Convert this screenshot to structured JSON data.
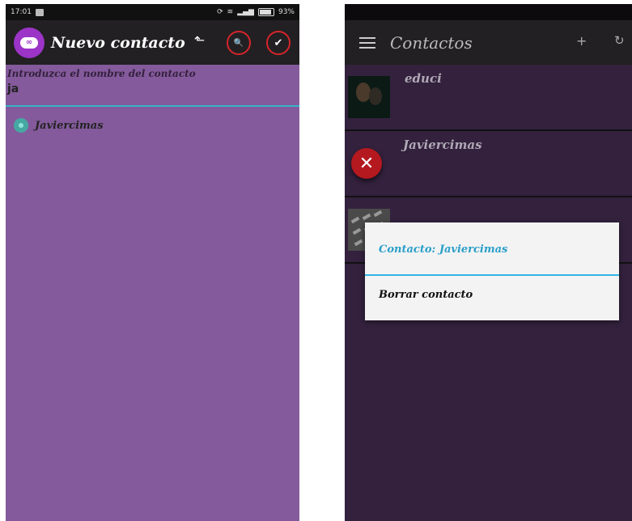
{
  "left": {
    "status": {
      "time": "17:01",
      "battery": "93%"
    },
    "toolbar": {
      "title": "Nuevo contacto",
      "logo_glyph": "∞",
      "back_glyph": "⬑",
      "search_glyph": "🔍",
      "accept_glyph": "✔"
    },
    "form": {
      "label": "Introduzca el nombre del contacto",
      "input_value": "ja"
    },
    "suggestions": [
      "Javiercimas"
    ]
  },
  "right": {
    "toolbar": {
      "title": "Contactos",
      "add_glyph": "+",
      "refresh_glyph": "↻"
    },
    "contacts": [
      {
        "name": "educi",
        "avatar": "photo"
      },
      {
        "name": "Javiercimas",
        "avatar": "close-icon"
      },
      {
        "name": "",
        "avatar": "keyboard-photo"
      }
    ],
    "dialog": {
      "title": "Contacto: Javiercimas",
      "items": [
        "Borrar contacto"
      ]
    }
  },
  "colors": {
    "left_background": "#845a9c",
    "right_background": "#33213d",
    "toolbar": "#222022",
    "accent": "#33b5e5",
    "action_ring": "#d6242b"
  }
}
